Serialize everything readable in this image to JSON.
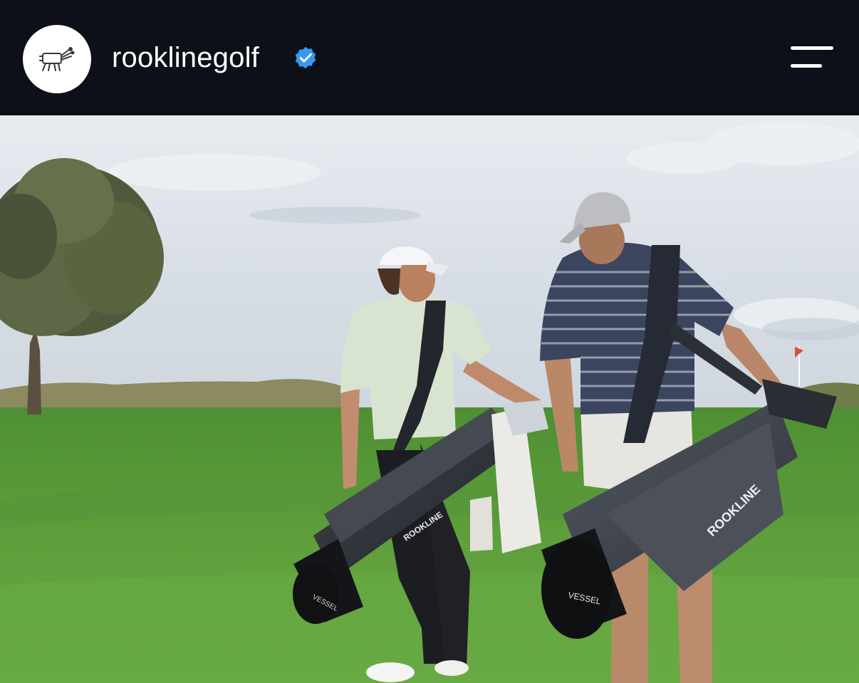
{
  "profile": {
    "username": "rooklinegolf",
    "verified": true,
    "avatar_icon": "golf-bag-logo-icon"
  },
  "header": {
    "menu_icon": "menu-icon"
  },
  "post": {
    "bag_brand_text": "ROOKLINE",
    "bag_maker_text": "VESSEL"
  },
  "colors": {
    "header_bg": "#0d1018",
    "verified_blue": "#3897f0",
    "grass": "#5b9a3a",
    "sky": "#dfe4ea"
  }
}
